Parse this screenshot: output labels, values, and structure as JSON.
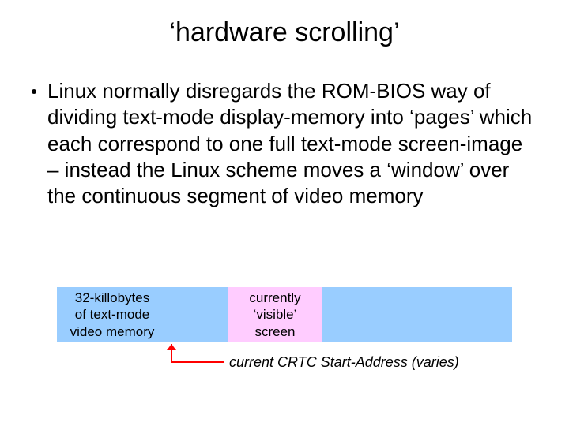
{
  "title": "‘hardware scrolling’",
  "bullet": "Linux normally disregards the ROM-BIOS way of dividing text-mode display-memory into ‘pages’ which each correspond to one full text-mode screen-image – instead the Linux scheme moves a ‘window’ over the continuous segment of video memory",
  "diagram": {
    "left_label_l1": "32-killobytes",
    "left_label_l2": "of text-mode",
    "left_label_l3": "video memory",
    "mid_label_l1": "currently",
    "mid_label_l2": "‘visible’",
    "mid_label_l3": "screen",
    "caption": "current CRTC Start-Address (varies)",
    "colors": {
      "bar": "#99cdff",
      "window": "#ffccff",
      "arrow": "#ff0000"
    }
  }
}
